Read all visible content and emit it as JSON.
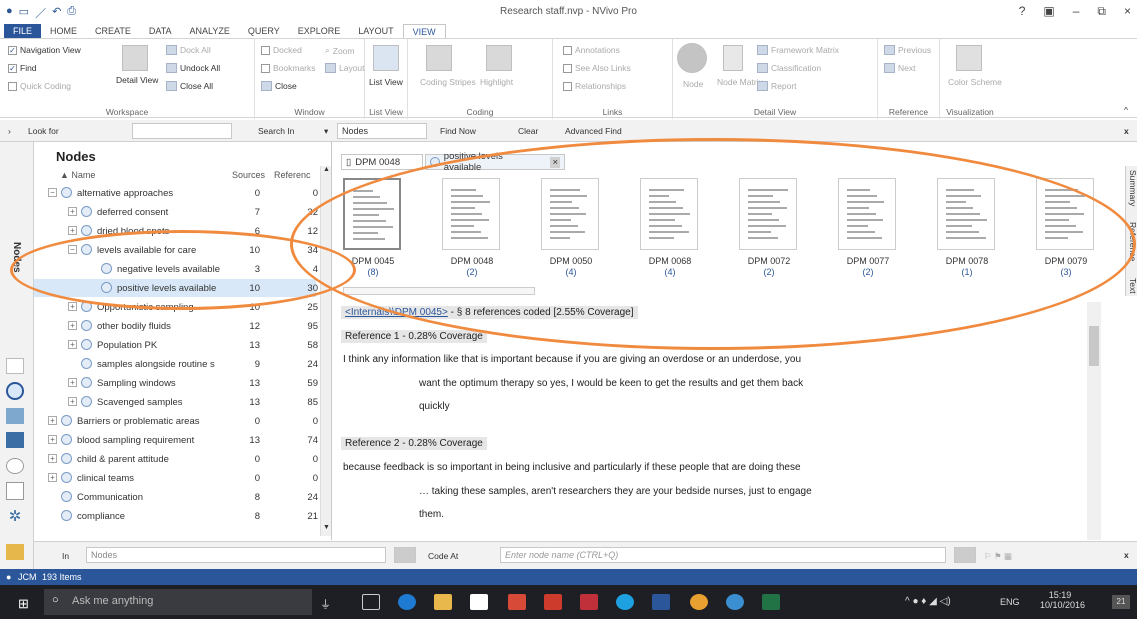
{
  "window": {
    "title": "Research staff.nvp - NVivo Pro",
    "help": "?",
    "min": "–",
    "max": "⧉",
    "close": "×"
  },
  "tabs": [
    "FILE",
    "HOME",
    "CREATE",
    "DATA",
    "ANALYZE",
    "QUERY",
    "EXPLORE",
    "LAYOUT",
    "VIEW"
  ],
  "ribbon": {
    "workspace": {
      "label": "Workspace",
      "nav": "Navigation View",
      "find": "Find",
      "quick": "Quick Coding",
      "detail": "Detail View",
      "dock_all": "Dock All",
      "undock_all": "Undock All",
      "close_all": "Close All"
    },
    "window": {
      "label": "Window",
      "docked": "Docked",
      "bookmarks": "Bookmarks",
      "close": "Close",
      "zoom": "Zoom",
      "layout": "Layout"
    },
    "listview": {
      "label": "List View",
      "list": "List View"
    },
    "coding": {
      "label": "Coding",
      "stripes": "Coding Stripes",
      "highlight": "Highlight"
    },
    "links": {
      "label": "Links",
      "annotations": "Annotations",
      "see_also": "See Also Links",
      "relationships": "Relationships"
    },
    "detailview": {
      "label": "Detail View",
      "node": "Node",
      "node_matrix": "Node Matrix",
      "framework": "Framework Matrix",
      "classification": "Classification",
      "report": "Report"
    },
    "reference": {
      "label": "Reference",
      "previous": "Previous",
      "next": "Next"
    },
    "visualization": {
      "label": "Visualization",
      "scheme": "Color Scheme"
    }
  },
  "findbar": {
    "look_for": "Look for",
    "search_in": "Search In",
    "scope": "Nodes",
    "find_now": "Find Now",
    "clear": "Clear",
    "advanced": "Advanced Find",
    "close": "x"
  },
  "leftnav": {
    "label": "Nodes"
  },
  "nodes": {
    "title": "Nodes",
    "col_name": "Name",
    "col_sources": "Sources",
    "col_refs": "Referenc",
    "rows": [
      {
        "name": "alternative approaches",
        "src": "0",
        "ref": "0",
        "level": 0,
        "ex": "−"
      },
      {
        "name": "deferred consent",
        "src": "7",
        "ref": "32",
        "level": 1,
        "ex": "+"
      },
      {
        "name": "dried blood spots",
        "src": "6",
        "ref": "12",
        "level": 1,
        "ex": "+"
      },
      {
        "name": "levels available for care",
        "src": "10",
        "ref": "34",
        "level": 1,
        "ex": "−"
      },
      {
        "name": "negative levels available",
        "src": "3",
        "ref": "4",
        "level": 2,
        "ex": ""
      },
      {
        "name": "positive levels available",
        "src": "10",
        "ref": "30",
        "level": 2,
        "ex": "",
        "selected": true
      },
      {
        "name": "Opportunistic sampling",
        "src": "10",
        "ref": "25",
        "level": 1,
        "ex": "+"
      },
      {
        "name": "other bodily fluids",
        "src": "12",
        "ref": "95",
        "level": 1,
        "ex": "+"
      },
      {
        "name": "Population PK",
        "src": "13",
        "ref": "58",
        "level": 1,
        "ex": "+"
      },
      {
        "name": "samples alongside routine s",
        "src": "9",
        "ref": "24",
        "level": 1,
        "ex": ""
      },
      {
        "name": "Sampling windows",
        "src": "13",
        "ref": "59",
        "level": 1,
        "ex": "+"
      },
      {
        "name": "Scavenged samples",
        "src": "13",
        "ref": "85",
        "level": 1,
        "ex": "+"
      },
      {
        "name": "Barriers or problematic areas",
        "src": "0",
        "ref": "0",
        "level": 0,
        "ex": "+"
      },
      {
        "name": "blood sampling requirement",
        "src": "13",
        "ref": "74",
        "level": 0,
        "ex": "+"
      },
      {
        "name": "child & parent attitude",
        "src": "0",
        "ref": "0",
        "level": 0,
        "ex": "+"
      },
      {
        "name": "clinical teams",
        "src": "0",
        "ref": "0",
        "level": 0,
        "ex": "+"
      },
      {
        "name": "Communication",
        "src": "8",
        "ref": "24",
        "level": 0,
        "ex": ""
      },
      {
        "name": "compliance",
        "src": "8",
        "ref": "21",
        "level": 0,
        "ex": ""
      }
    ]
  },
  "detail": {
    "tab1": "DPM 0048",
    "tab2": "positive levels available",
    "tab2_close": "×",
    "thumbs": [
      {
        "name": "DPM 0045",
        "count": "(8)"
      },
      {
        "name": "DPM 0048",
        "count": "(2)"
      },
      {
        "name": "DPM 0050",
        "count": "(4)"
      },
      {
        "name": "DPM 0068",
        "count": "(4)"
      },
      {
        "name": "DPM 0072",
        "count": "(2)"
      },
      {
        "name": "DPM 0077",
        "count": "(2)"
      },
      {
        "name": "DPM 0078",
        "count": "(1)"
      },
      {
        "name": "DPM 0079",
        "count": "(3)"
      }
    ],
    "side_summary": "Summary",
    "side_reference": "Reference",
    "side_text": "Text",
    "header_link": "<Internals\\\\DPM 0045>",
    "header_rest": " - § 8 references coded  [2.55% Coverage]",
    "ref1": "Reference 1 - 0.28% Coverage",
    "ref1_lines": [
      "I think any information like that is important because if you are giving an overdose or an underdose, you",
      "want the optimum therapy so yes, I would be keen to get the results and get them back",
      "quickly"
    ],
    "ref2": "Reference 2 - 0.28% Coverage",
    "ref2_lines": [
      "because feedback is so important in being inclusive and particularly if these people that are doing these",
      "… taking these samples, aren't researchers they are your bedside nurses, just to engage",
      "them."
    ]
  },
  "codebar": {
    "in": "In",
    "nodes": "Nodes",
    "code_at": "Code At",
    "placeholder": "Enter node name (CTRL+Q)",
    "close": "x"
  },
  "status": {
    "user": "JCM",
    "items": "193 Items"
  },
  "taskbar": {
    "search": "Ask me anything",
    "lang": "ENG",
    "time": "15:19",
    "date": "10/10/2016",
    "notif": "21"
  },
  "colors": {
    "accent": "#2b579a",
    "annotation": "#f08a3e"
  }
}
